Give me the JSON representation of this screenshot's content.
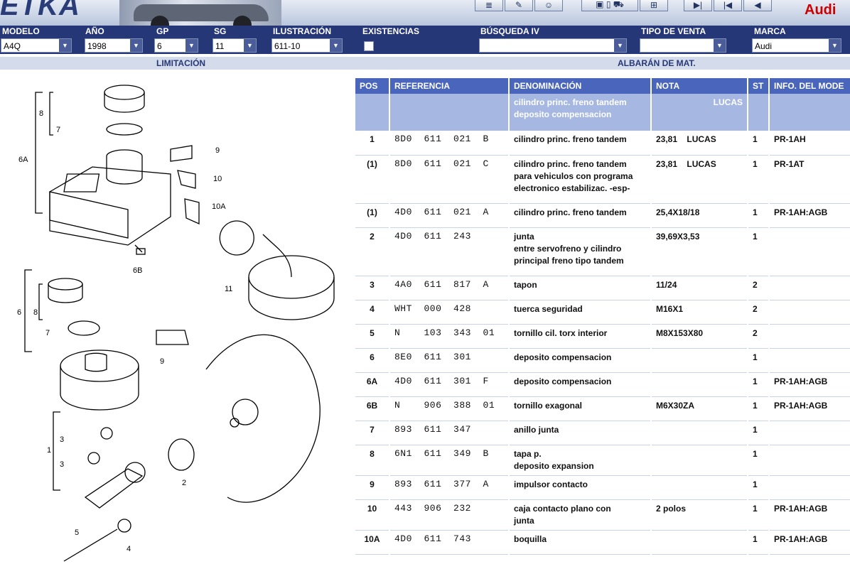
{
  "brand": {
    "title": "ETKA",
    "audi": "Audi"
  },
  "header": {
    "labels": [
      "MODELO",
      "AÑO",
      "GP",
      "SG",
      "ILUSTRACIÓN",
      "EXISTENCIAS",
      "BÚSQUEDA IV",
      "TIPO DE VENTA",
      "MARCA"
    ]
  },
  "fields": {
    "modelo": "A4Q",
    "ano": "1998",
    "gp": "6",
    "sg": "11",
    "ilustracion": "611-10",
    "busqueda": "",
    "tipo_venta": "",
    "marca": "Audi"
  },
  "sub": {
    "limitacion": "LIMITACIÓN",
    "albaran": "ALBARÁN DE MAT."
  },
  "table": {
    "columns": [
      "POS",
      "REFERENCIA",
      "DENOMINACIÓN",
      "NOTA",
      "ST",
      "INFO. DEL MODE"
    ],
    "header_row": {
      "denominacion1": "cilindro princ. freno tandem",
      "denominacion2": "deposito compensacion",
      "nota": "LUCAS"
    },
    "rows": [
      {
        "pos": "1",
        "ref": "8D0  611  021  B",
        "den": [
          "cilindro princ. freno tandem"
        ],
        "nota": "23,81    LUCAS",
        "st": "1",
        "info": "PR-1AH"
      },
      {
        "pos": "(1)",
        "ref": "8D0  611  021  C",
        "den": [
          "cilindro princ. freno tandem",
          "para vehiculos con programa",
          "electronico estabilizac. -esp-"
        ],
        "nota": "23,81    LUCAS",
        "st": "1",
        "info": "PR-1AT"
      },
      {
        "pos": "(1)",
        "ref": "4D0  611  021  A",
        "den": [
          "cilindro princ. freno tandem"
        ],
        "nota": "25,4X18/18",
        "st": "1",
        "info": "PR-1AH:AGB"
      },
      {
        "pos": "2",
        "ref": "4D0  611  243",
        "den": [
          "junta",
          "entre servofreno y cilindro",
          "principal freno tipo tandem"
        ],
        "nota": "39,69X3,53",
        "st": "1",
        "info": ""
      },
      {
        "pos": "3",
        "ref": "4A0  611  817  A",
        "den": [
          "tapon"
        ],
        "nota": "11/24",
        "st": "2",
        "info": ""
      },
      {
        "pos": "4",
        "ref": "WHT  000  428",
        "den": [
          "tuerca seguridad"
        ],
        "nota": "M16X1",
        "st": "2",
        "info": ""
      },
      {
        "pos": "5",
        "ref": "N    103  343  01",
        "den": [
          "tornillo cil. torx interior"
        ],
        "nota": "M8X153X80",
        "st": "2",
        "info": ""
      },
      {
        "pos": "6",
        "ref": "8E0  611  301",
        "den": [
          "deposito compensacion"
        ],
        "nota": "",
        "st": "1",
        "info": ""
      },
      {
        "pos": "6A",
        "ref": "4D0  611  301  F",
        "den": [
          "deposito compensacion"
        ],
        "nota": "",
        "st": "1",
        "info": "PR-1AH:AGB"
      },
      {
        "pos": "6B",
        "ref": "N    906  388  01",
        "den": [
          "tornillo exagonal"
        ],
        "nota": "M6X30ZA",
        "st": "1",
        "info": "PR-1AH:AGB"
      },
      {
        "pos": "7",
        "ref": "893  611  347",
        "den": [
          "anillo junta"
        ],
        "nota": "",
        "st": "1",
        "info": ""
      },
      {
        "pos": "8",
        "ref": "6N1  611  349  B",
        "den": [
          "tapa p.",
          "deposito expansion"
        ],
        "nota": "",
        "st": "1",
        "info": ""
      },
      {
        "pos": "9",
        "ref": "893  611  377  A",
        "den": [
          "impulsor contacto"
        ],
        "nota": "",
        "st": "1",
        "info": ""
      },
      {
        "pos": "10",
        "ref": "443  906  232",
        "den": [
          "caja contacto plano con",
          "junta"
        ],
        "nota": "2 polos",
        "st": "1",
        "info": "PR-1AH:AGB"
      },
      {
        "pos": "10A",
        "ref": "4D0  611  743",
        "den": [
          "boquilla"
        ],
        "nota": "",
        "st": "1",
        "info": "PR-1AH:AGB"
      }
    ]
  },
  "diagram_labels": [
    "8",
    "7",
    "6A",
    "9",
    "10",
    "10A",
    "6B",
    "11",
    "6",
    "8",
    "7",
    "9",
    "1",
    "3",
    "3",
    "2",
    "5",
    "4"
  ]
}
